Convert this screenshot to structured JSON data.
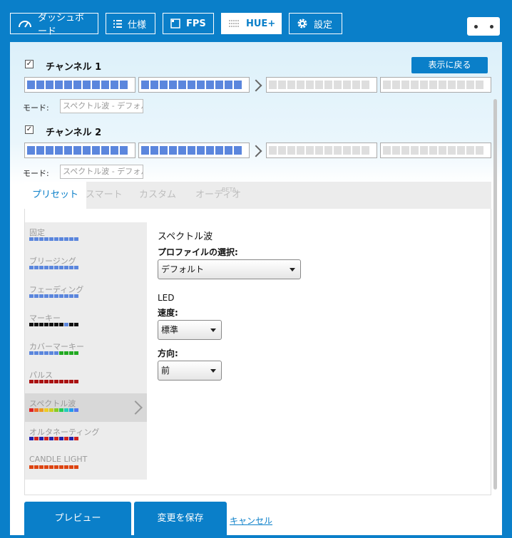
{
  "nav": {
    "tabs": [
      {
        "label": "ダッシュボード",
        "icon": "gauge-icon"
      },
      {
        "label": "仕様",
        "icon": "list-icon"
      },
      {
        "label": "FPS",
        "icon": "square-icon"
      },
      {
        "label": "HUE+",
        "icon": "grid-icon",
        "active": true
      },
      {
        "label": "設定",
        "icon": "gear-icon"
      }
    ],
    "device_icon": "device-icon"
  },
  "channels": {
    "back_label": "表示に戻る",
    "mode_label": "モード:",
    "list": [
      {
        "name": "チャンネル 1",
        "checked": true,
        "mode_value": "スペクトル波 - デフォルト"
      },
      {
        "name": "チャンネル 2",
        "checked": true,
        "mode_value": "スペクトル波 - デフォルト"
      }
    ]
  },
  "tabs": {
    "items": [
      "プリセット",
      "スマート",
      "カスタム",
      "オーディオ"
    ],
    "beta": "BETA",
    "active": "プリセット"
  },
  "presets": {
    "items": [
      {
        "label": "固定",
        "colors": [
          "#5b86dd",
          "#5b86dd",
          "#5b86dd",
          "#5b86dd",
          "#5b86dd",
          "#5b86dd",
          "#5b86dd",
          "#5b86dd",
          "#5b86dd",
          "#5b86dd"
        ]
      },
      {
        "label": "ブリージング",
        "colors": [
          "#5b86dd",
          "#5b86dd",
          "#5b86dd",
          "#5b86dd",
          "#5b86dd",
          "#5b86dd",
          "#5b86dd",
          "#5b86dd",
          "#5b86dd",
          "#5b86dd"
        ]
      },
      {
        "label": "フェーディング",
        "colors": [
          "#5b86dd",
          "#5b86dd",
          "#5b86dd",
          "#5b86dd",
          "#5b86dd",
          "#5b86dd",
          "#5b86dd",
          "#5b86dd",
          "#5b86dd",
          "#5b86dd"
        ]
      },
      {
        "label": "マーキー",
        "colors": [
          "#111111",
          "#111111",
          "#111111",
          "#111111",
          "#111111",
          "#111111",
          "#111111",
          "#5b86dd",
          "#111111",
          "#111111"
        ]
      },
      {
        "label": "カバーマーキー",
        "colors": [
          "#5b86dd",
          "#5b86dd",
          "#5b86dd",
          "#5b86dd",
          "#5b86dd",
          "#5b86dd",
          "#22aa22",
          "#22aa22",
          "#22aa22",
          "#22aa22"
        ]
      },
      {
        "label": "パルス",
        "colors": [
          "#aa1111",
          "#aa1111",
          "#aa1111",
          "#aa1111",
          "#aa1111",
          "#aa1111",
          "#aa1111",
          "#aa1111",
          "#aa1111",
          "#aa1111"
        ]
      },
      {
        "label": "スペクトル波",
        "colors": [
          "#dd2222",
          "#ee6622",
          "#ee9922",
          "#eecc22",
          "#cccc22",
          "#88cc22",
          "#22cc55",
          "#22ccbb",
          "#2299ee",
          "#5577ee"
        ],
        "selected": true
      },
      {
        "label": "オルタネーティング",
        "colors": [
          "#2222aa",
          "#cc2222",
          "#2222aa",
          "#cc2222",
          "#2222aa",
          "#cc2222",
          "#2222aa",
          "#cc2222",
          "#2222aa",
          "#cc2222"
        ]
      },
      {
        "label": "CANDLE LIGHT",
        "colors": [
          "#dd4411",
          "#dd4411",
          "#dd4411",
          "#dd4411",
          "#dd4411",
          "#dd4411",
          "#dd4411",
          "#dd4411",
          "#dd4411",
          "#dd4411"
        ]
      }
    ]
  },
  "panel": {
    "title": "スペクトル波",
    "profile_label": "プロファイルの選択:",
    "profile_value": "デフォルト",
    "led_label": "LED",
    "speed_label": "速度:",
    "speed_value": "標準",
    "direction_label": "方向:",
    "direction_value": "前"
  },
  "footer": {
    "preview": "プレビュー",
    "save": "変更を保存",
    "cancel": "キャンセル"
  },
  "colors": {
    "accent": "#0a7fc9",
    "led_on": "#5b86dd",
    "led_off": "#dedede"
  }
}
